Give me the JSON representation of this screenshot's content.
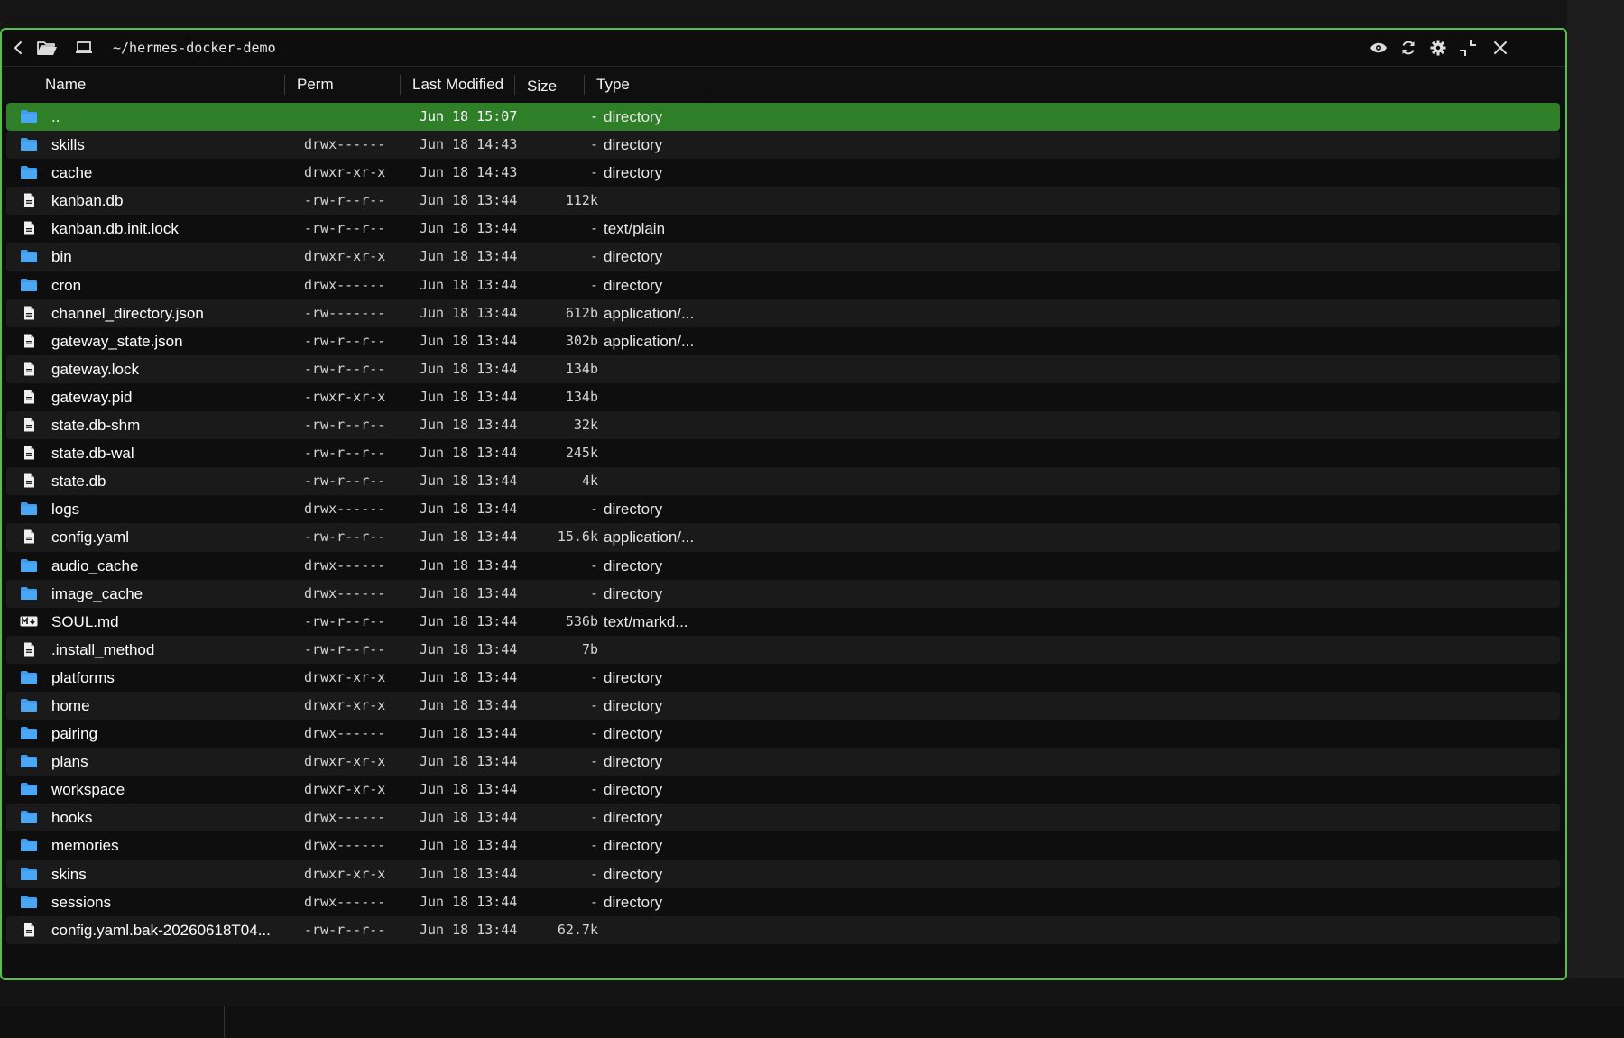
{
  "window": {
    "path": "~/hermes-docker-demo",
    "accent": "#55c04c"
  },
  "columns": {
    "name": "Name",
    "perm": "Perm",
    "modified": "Last Modified",
    "size": "Size",
    "type": "Type"
  },
  "files": [
    {
      "icon": "folder-icon",
      "name": "..",
      "perm": "",
      "modified": "Jun 18 15:07",
      "size": "-",
      "type": "directory",
      "selected": true
    },
    {
      "icon": "folder-icon",
      "name": "skills",
      "perm": "drwx------",
      "modified": "Jun 18 14:43",
      "size": "-",
      "type": "directory"
    },
    {
      "icon": "folder-icon",
      "name": "cache",
      "perm": "drwxr-xr-x",
      "modified": "Jun 18 14:43",
      "size": "-",
      "type": "directory"
    },
    {
      "icon": "file-icon",
      "name": "kanban.db",
      "perm": "-rw-r--r--",
      "modified": "Jun 18 13:44",
      "size": "112k",
      "type": ""
    },
    {
      "icon": "file-icon",
      "name": "kanban.db.init.lock",
      "perm": "-rw-r--r--",
      "modified": "Jun 18 13:44",
      "size": "-",
      "type": "text/plain"
    },
    {
      "icon": "folder-icon",
      "name": "bin",
      "perm": "drwxr-xr-x",
      "modified": "Jun 18 13:44",
      "size": "-",
      "type": "directory"
    },
    {
      "icon": "folder-icon",
      "name": "cron",
      "perm": "drwx------",
      "modified": "Jun 18 13:44",
      "size": "-",
      "type": "directory"
    },
    {
      "icon": "file-icon",
      "name": "channel_directory.json",
      "perm": "-rw-------",
      "modified": "Jun 18 13:44",
      "size": "612b",
      "type": "application/..."
    },
    {
      "icon": "file-icon",
      "name": "gateway_state.json",
      "perm": "-rw-r--r--",
      "modified": "Jun 18 13:44",
      "size": "302b",
      "type": "application/..."
    },
    {
      "icon": "file-icon",
      "name": "gateway.lock",
      "perm": "-rw-r--r--",
      "modified": "Jun 18 13:44",
      "size": "134b",
      "type": ""
    },
    {
      "icon": "file-icon",
      "name": "gateway.pid",
      "perm": "-rwxr-xr-x",
      "modified": "Jun 18 13:44",
      "size": "134b",
      "type": ""
    },
    {
      "icon": "file-icon",
      "name": "state.db-shm",
      "perm": "-rw-r--r--",
      "modified": "Jun 18 13:44",
      "size": "32k",
      "type": ""
    },
    {
      "icon": "file-icon",
      "name": "state.db-wal",
      "perm": "-rw-r--r--",
      "modified": "Jun 18 13:44",
      "size": "245k",
      "type": ""
    },
    {
      "icon": "file-icon",
      "name": "state.db",
      "perm": "-rw-r--r--",
      "modified": "Jun 18 13:44",
      "size": "4k",
      "type": ""
    },
    {
      "icon": "folder-icon",
      "name": "logs",
      "perm": "drwx------",
      "modified": "Jun 18 13:44",
      "size": "-",
      "type": "directory"
    },
    {
      "icon": "file-icon",
      "name": "config.yaml",
      "perm": "-rw-r--r--",
      "modified": "Jun 18 13:44",
      "size": "15.6k",
      "type": "application/..."
    },
    {
      "icon": "folder-icon",
      "name": "audio_cache",
      "perm": "drwx------",
      "modified": "Jun 18 13:44",
      "size": "-",
      "type": "directory"
    },
    {
      "icon": "folder-icon",
      "name": "image_cache",
      "perm": "drwx------",
      "modified": "Jun 18 13:44",
      "size": "-",
      "type": "directory"
    },
    {
      "icon": "markdown-icon",
      "name": "SOUL.md",
      "perm": "-rw-r--r--",
      "modified": "Jun 18 13:44",
      "size": "536b",
      "type": "text/markd..."
    },
    {
      "icon": "file-icon",
      "name": ".install_method",
      "perm": "-rw-r--r--",
      "modified": "Jun 18 13:44",
      "size": "7b",
      "type": ""
    },
    {
      "icon": "folder-icon",
      "name": "platforms",
      "perm": "drwxr-xr-x",
      "modified": "Jun 18 13:44",
      "size": "-",
      "type": "directory"
    },
    {
      "icon": "folder-icon",
      "name": "home",
      "perm": "drwxr-xr-x",
      "modified": "Jun 18 13:44",
      "size": "-",
      "type": "directory"
    },
    {
      "icon": "folder-icon",
      "name": "pairing",
      "perm": "drwx------",
      "modified": "Jun 18 13:44",
      "size": "-",
      "type": "directory"
    },
    {
      "icon": "folder-icon",
      "name": "plans",
      "perm": "drwxr-xr-x",
      "modified": "Jun 18 13:44",
      "size": "-",
      "type": "directory"
    },
    {
      "icon": "folder-icon",
      "name": "workspace",
      "perm": "drwxr-xr-x",
      "modified": "Jun 18 13:44",
      "size": "-",
      "type": "directory"
    },
    {
      "icon": "folder-icon",
      "name": "hooks",
      "perm": "drwx------",
      "modified": "Jun 18 13:44",
      "size": "-",
      "type": "directory"
    },
    {
      "icon": "folder-icon",
      "name": "memories",
      "perm": "drwx------",
      "modified": "Jun 18 13:44",
      "size": "-",
      "type": "directory"
    },
    {
      "icon": "folder-icon",
      "name": "skins",
      "perm": "drwxr-xr-x",
      "modified": "Jun 18 13:44",
      "size": "-",
      "type": "directory"
    },
    {
      "icon": "folder-icon",
      "name": "sessions",
      "perm": "drwx------",
      "modified": "Jun 18 13:44",
      "size": "-",
      "type": "directory"
    },
    {
      "icon": "file-icon",
      "name": "config.yaml.bak-20260618T04...",
      "perm": "-rw-r--r--",
      "modified": "Jun 18 13:44",
      "size": "62.7k",
      "type": ""
    }
  ],
  "colors": {
    "folder": "#3d9bf0",
    "selected_row": "#2f7f29"
  }
}
